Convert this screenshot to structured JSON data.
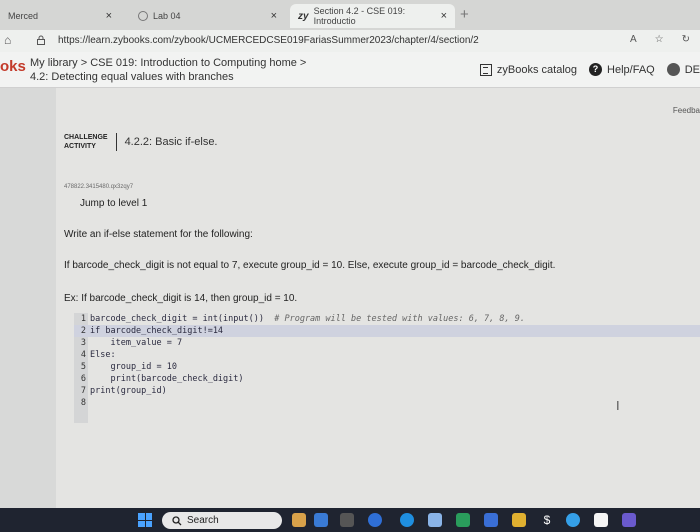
{
  "browser": {
    "tabs": [
      {
        "label": "Merced"
      },
      {
        "label": "Lab 04"
      },
      {
        "label": "Section 4.2 - CSE 019: Introductio"
      }
    ],
    "tab_close": "×",
    "new_tab": "+",
    "url": "https://learn.zybooks.com/zybook/UCMERCEDCSE019FariasSummer2023/chapter/4/section/2"
  },
  "header": {
    "logo_text": "oks",
    "breadcrumb_line1": "My library > CSE 019: Introduction to Computing home >",
    "breadcrumb_line2": "4.2: Detecting equal values with branches",
    "catalog": "zyBooks catalog",
    "help": "Help/FAQ",
    "user": "DE"
  },
  "content": {
    "feedback": "Feedba",
    "challenge_label_1": "CHALLENGE",
    "challenge_label_2": "ACTIVITY",
    "challenge_title": "4.2.2: Basic if-else.",
    "activity_id": "478822.3415480.qx3zqy7",
    "jump_level": "Jump to level 1",
    "prompt1": "Write an if-else statement for the following:",
    "prompt2": "If barcode_check_digit is not equal to 7, execute group_id = 10. Else, execute group_id = barcode_check_digit.",
    "prompt3": "Ex: If barcode_check_digit is 14, then group_id = 10."
  },
  "code": {
    "lines": [
      {
        "n": "1",
        "code": "barcode_check_digit = int(input())",
        "comment": "  # Program will be tested with values: 6, 7, 8, 9."
      },
      {
        "n": "2",
        "code": "if barcode_check_digit!=14",
        "comment": ""
      },
      {
        "n": "3",
        "code": "    item_value = 7",
        "comment": ""
      },
      {
        "n": "4",
        "code": "Else:",
        "comment": ""
      },
      {
        "n": "5",
        "code": "    group_id = 10",
        "comment": ""
      },
      {
        "n": "6",
        "code": "    print(barcode_check_digit)",
        "comment": ""
      },
      {
        "n": "7",
        "code": "print(group_id)",
        "comment": ""
      },
      {
        "n": "8",
        "code": "",
        "comment": ""
      }
    ]
  },
  "taskbar": {
    "search": "Search"
  }
}
